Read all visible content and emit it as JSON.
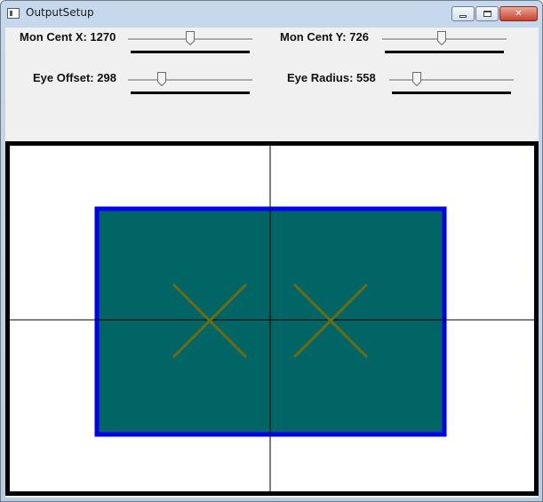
{
  "window": {
    "title": "OutputSetup",
    "minimize_label": "",
    "maximize_label": "",
    "close_label": "✕"
  },
  "sliders": {
    "mon_cent_x": {
      "label": "Mon Cent X: 1270",
      "level_percent": 50
    },
    "mon_cent_y": {
      "label": "Mon Cent Y: 726",
      "level_percent": 48
    },
    "eye_offset": {
      "label": "Eye Offset: 298",
      "level_percent": 25
    },
    "eye_radius": {
      "label": "Eye Radius: 558",
      "level_percent": 20
    }
  },
  "colors": {
    "monitor_fill": "#026565",
    "monitor_border": "#0000ee",
    "eye_marker": "#6b6b10",
    "crosshair": "#000000",
    "canvas_border": "#000000"
  }
}
